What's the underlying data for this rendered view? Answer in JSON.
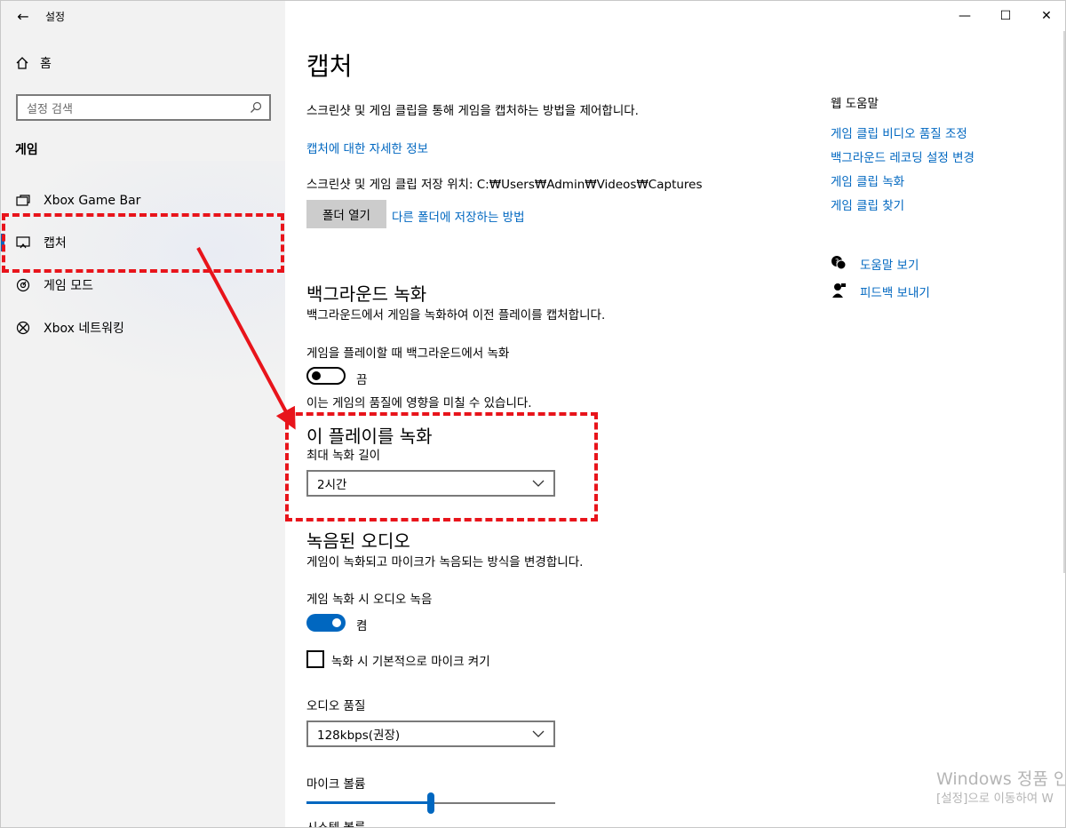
{
  "window": {
    "title": "설정",
    "back_icon": "←",
    "minimize_icon": "—",
    "maximize_icon": "☐",
    "close_icon": "✕"
  },
  "sidebar": {
    "home_label": "홈",
    "search_placeholder": "설정 검색",
    "section_label": "게임",
    "items": [
      {
        "label": "Xbox Game Bar",
        "icon": "game-bar-icon"
      },
      {
        "label": "캡처",
        "icon": "capture-icon",
        "selected": true
      },
      {
        "label": "게임 모드",
        "icon": "game-mode-icon"
      },
      {
        "label": "Xbox 네트워킹",
        "icon": "xbox-icon"
      }
    ]
  },
  "main": {
    "title": "캡처",
    "description": "스크린샷 및 게임 클립을 통해 게임을 캡처하는 방법을 제어합니다.",
    "more_info_link": "캡처에 대한 자세한 정보",
    "save_location": "스크린샷 및 게임 클립 저장 위치: C:₩Users₩Admin₩Videos₩Captures",
    "open_folder_button": "폴더 열기",
    "save_other_folder_link": "다른 폴더에 저장하는 방법",
    "background_recording": {
      "heading": "백그라운드 녹화",
      "description": "백그라운드에서 게임을 녹화하여 이전 플레이를 캡처합니다.",
      "toggle_label": "게임을 플레이할 때 백그라운드에서 녹화",
      "toggle_state": "끔",
      "note": "이는 게임의 품질에 영향을 미칠 수 있습니다."
    },
    "record_this": {
      "heading": "이 플레이를 녹화",
      "label": "최대 녹화 길이",
      "value": "2시간"
    },
    "recorded_audio": {
      "heading": "녹음된 오디오",
      "description": "게임이 녹화되고 마이크가 녹음되는 방식을 변경합니다.",
      "toggle_label": "게임 녹화 시 오디오 녹음",
      "toggle_state": "켬",
      "checkbox_label": "녹화 시 기본적으로 마이크 켜기",
      "checkbox_checked": false,
      "quality_label": "오디오 품질",
      "quality_value": "128kbps(권장)",
      "mic_volume_label": "마이크 볼륨",
      "mic_volume_level": 0.5,
      "system_volume_label": "시스템 볼륨"
    }
  },
  "help": {
    "heading": "웹 도움말",
    "links": [
      "게임 클립 비디오 품질 조정",
      "백그라운드 레코딩 설정 변경",
      "게임 클립 녹화",
      "게임 클립 찾기"
    ],
    "get_help": "도움말 보기",
    "feedback": "피드백 보내기"
  },
  "watermark": {
    "line1": "Windows 정품 인",
    "line2": "[설정]으로 이동하여 W"
  },
  "colors": {
    "accent": "#0067c0",
    "annotation": "#e8141b"
  }
}
